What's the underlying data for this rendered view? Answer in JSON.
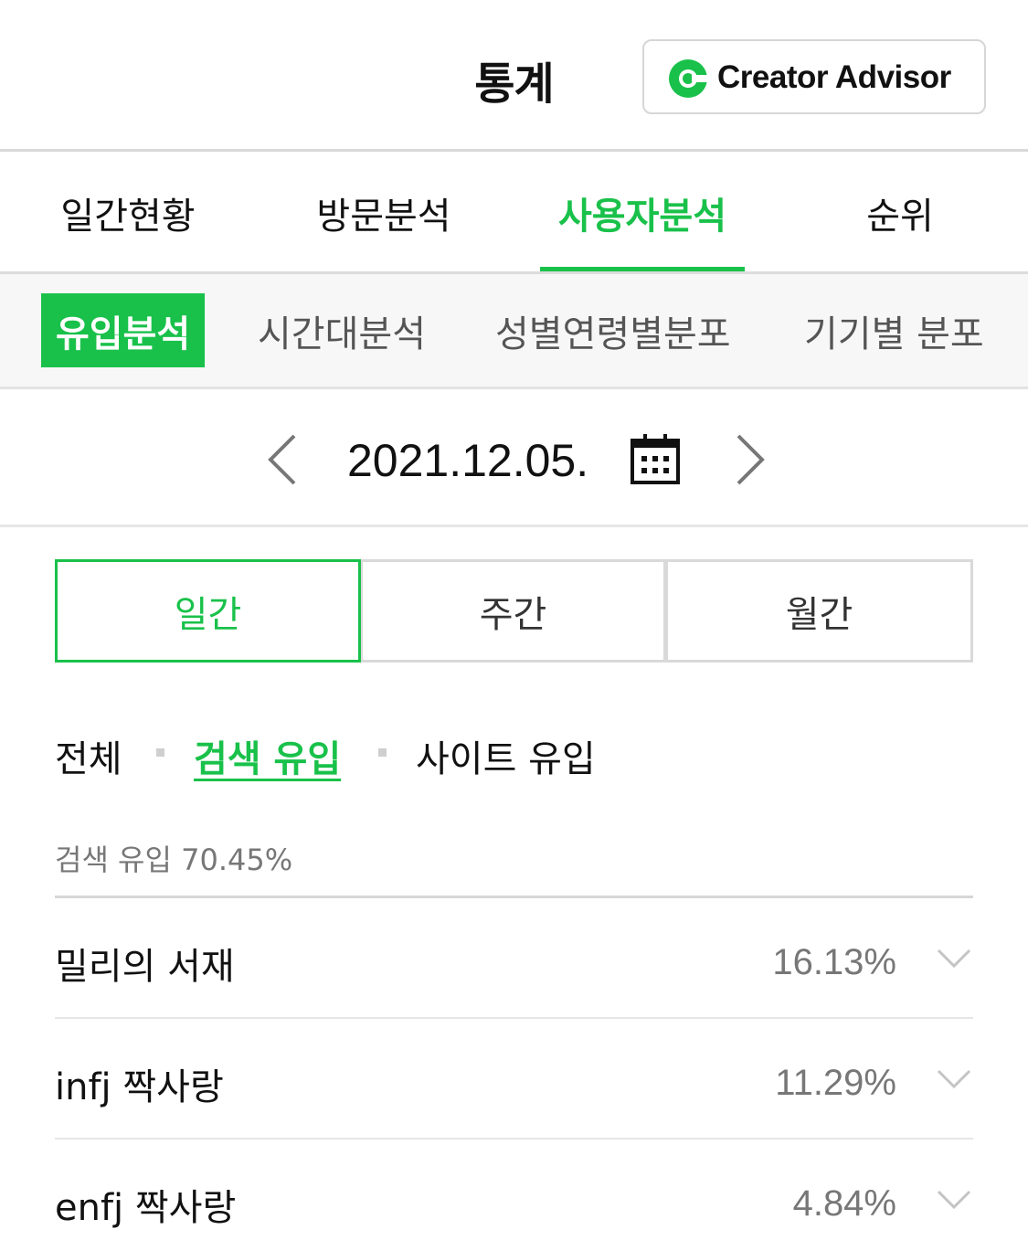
{
  "header": {
    "title": "통계",
    "creator_advisor": {
      "label": "Creator Advisor",
      "icon": "creator-advisor-logo"
    }
  },
  "main_tabs": [
    {
      "label": "일간현황",
      "active": false
    },
    {
      "label": "방문분석",
      "active": false
    },
    {
      "label": "사용자분석",
      "active": true
    },
    {
      "label": "순위",
      "active": false
    }
  ],
  "sub_tabs": [
    {
      "label": "유입분석",
      "active": true
    },
    {
      "label": "시간대분석",
      "active": false
    },
    {
      "label": "성별연령별분포",
      "active": false
    },
    {
      "label": "기기별 분포",
      "active": false
    }
  ],
  "date_nav": {
    "prev_icon": "chevron-left-icon",
    "date": "2021.12.05.",
    "calendar_icon": "calendar-icon",
    "next_icon": "chevron-right-icon"
  },
  "period": [
    {
      "label": "일간",
      "active": true
    },
    {
      "label": "주간",
      "active": false
    },
    {
      "label": "월간",
      "active": false
    }
  ],
  "filters": [
    {
      "label": "전체",
      "active": false
    },
    {
      "label": "검색 유입",
      "active": true
    },
    {
      "label": "사이트 유입",
      "active": false
    }
  ],
  "summary": "검색 유입 70.45%",
  "keywords": [
    {
      "keyword": "밀리의 서재",
      "percent": "16.13%"
    },
    {
      "keyword": "infj 짝사랑",
      "percent": "11.29%"
    },
    {
      "keyword": "enfj 짝사랑",
      "percent": "4.84%"
    }
  ],
  "colors": {
    "accent": "#19c14a",
    "text": "#111111",
    "muted": "#777777",
    "border": "#d9d9d9"
  }
}
